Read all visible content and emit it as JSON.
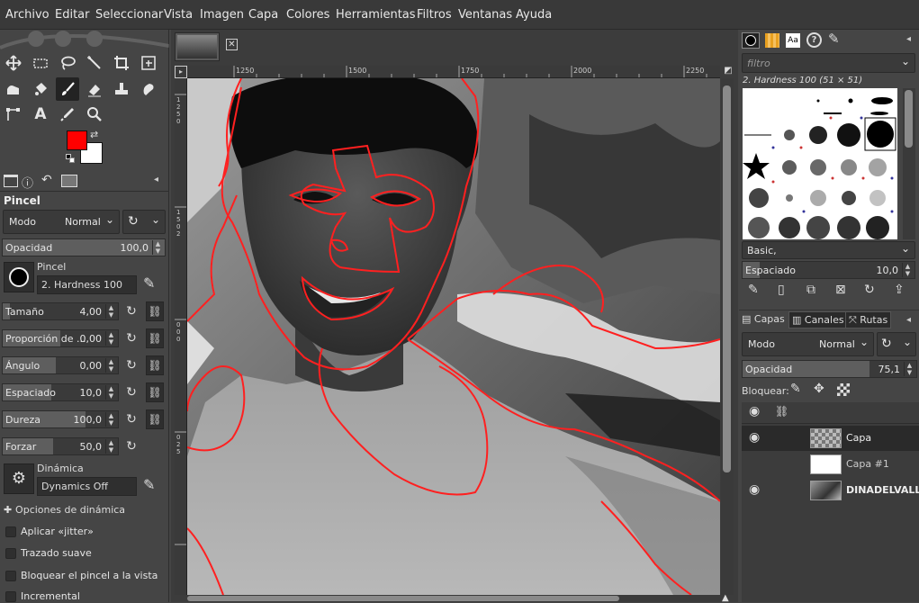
{
  "menu": [
    "Archivo",
    "Editar",
    "Seleccionar",
    "Vista",
    "Imagen",
    "Capa",
    "Colores",
    "Herramientas",
    "Filtros",
    "Ventanas",
    "Ayuda"
  ],
  "colors": {
    "fg": "#ff0000",
    "bg": "#ffffff",
    "accent": "#ff2020"
  },
  "toolbox": {
    "tools": [
      "move-icon",
      "rect-select-icon",
      "lasso-icon",
      "fuzzy-select-icon",
      "crop-icon",
      "transform-icon",
      "warp-icon",
      "bucket-fill-icon",
      "paintbrush-icon",
      "eraser-icon",
      "clone-icon",
      "smudge-icon",
      "paths-icon",
      "text-icon",
      "color-picker-icon",
      "zoom-icon"
    ]
  },
  "tool_options": {
    "title": "Pincel",
    "mode_label": "Modo",
    "mode_value": "Normal",
    "opacity_label": "Opacidad",
    "opacity_value": "100,0",
    "brush_label": "Pincel",
    "brush_name": "2. Hardness 100",
    "sliders": [
      {
        "label": "Tamaño",
        "value": "4,00",
        "level": 0.06
      },
      {
        "label": "Proporción de ...",
        "value": "0,00",
        "level": 0.5
      },
      {
        "label": "Ángulo",
        "value": "0,00",
        "level": 0.5
      },
      {
        "label": "Espaciado",
        "value": "10,0",
        "level": 0.1
      },
      {
        "label": "Dureza",
        "value": "100,0",
        "level": 1.0
      },
      {
        "label": "Forzar",
        "value": "50,0",
        "level": 0.5
      }
    ],
    "dynamics_label": "Dinámica",
    "dynamics_value": "Dynamics Off",
    "dynamics_options": "Opciones de dinámica",
    "checks": [
      "Aplicar «jitter»",
      "Trazado suave",
      "Bloquear el pincel a la vista",
      "Incremental"
    ]
  },
  "ruler": {
    "marks": [
      "1250",
      "1500",
      "1750",
      "2000",
      "2250"
    ],
    "vmarks": [
      "1",
      "2",
      "5",
      "0",
      "1",
      "5",
      "0",
      "2",
      "0",
      "0",
      "0",
      "0",
      "2",
      "5"
    ]
  },
  "brushes": {
    "filter_placeholder": "filtro",
    "selected": "2. Hardness 100 (51 × 51)",
    "tag": "Basic,",
    "spacing_label": "Espaciado",
    "spacing_value": "10,0"
  },
  "layers": {
    "tabs": [
      "Capas",
      "Canales",
      "Rutas"
    ],
    "mode_label": "Modo",
    "mode_value": "Normal",
    "opacity_label": "Opacidad",
    "opacity_value": "75,1",
    "lock_label": "Bloquear:",
    "items": [
      {
        "name": "Capa",
        "visible": true,
        "active": true
      },
      {
        "name": "Capa #1",
        "visible": false,
        "active": false
      },
      {
        "name": "DINADELVALLE.j",
        "visible": true,
        "active": false
      }
    ]
  }
}
